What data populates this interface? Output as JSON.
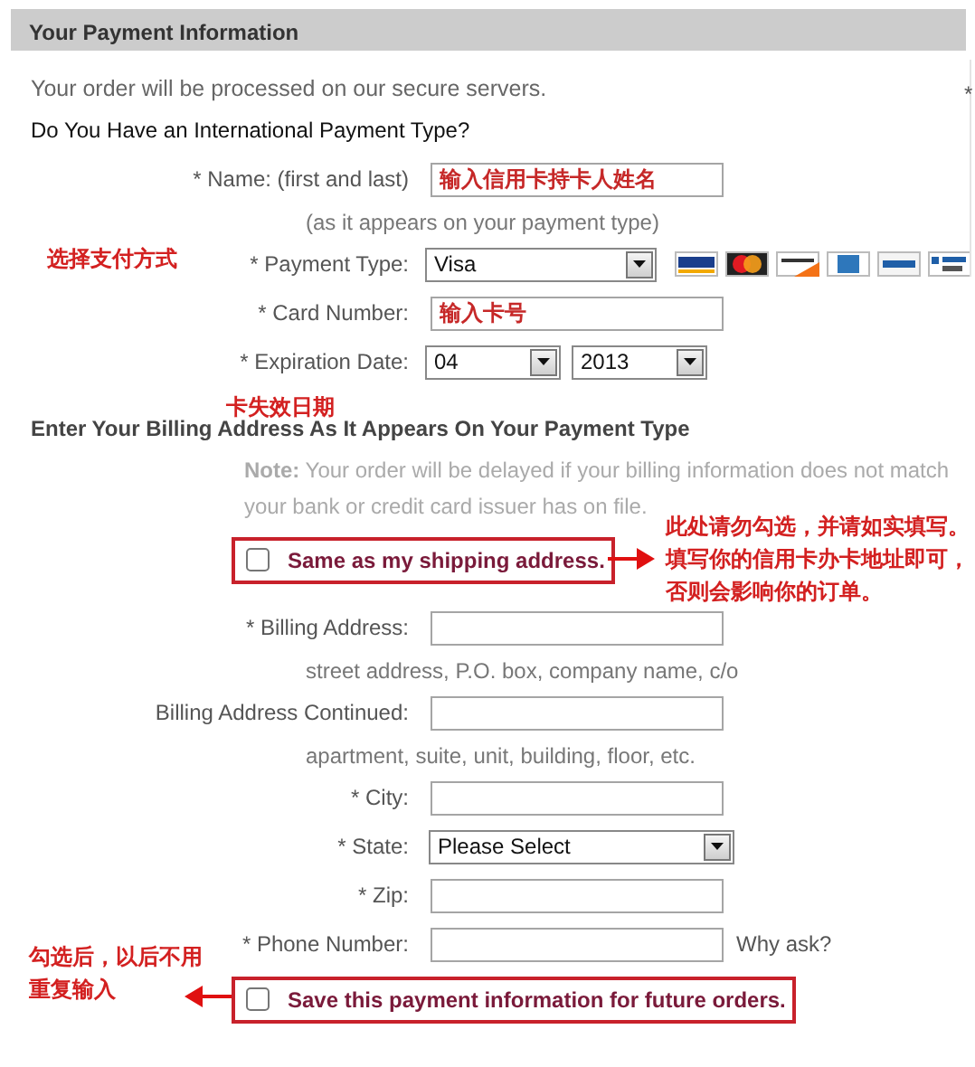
{
  "header": {
    "title": "Your Payment Information"
  },
  "edge_mark": "*",
  "intro": "Your order will be processed on our secure servers.",
  "question": "Do You Have an International Payment Type?",
  "payment_fields": [
    {
      "kind": "input",
      "label": "* Name: (first and last)",
      "value": "输入信用卡持卡人姓名",
      "hint": "(as it appears on your payment type)"
    },
    {
      "kind": "select",
      "label": "* Payment Type:",
      "value": "Visa"
    },
    {
      "kind": "input",
      "label": "* Card Number:",
      "value": "输入卡号"
    },
    {
      "kind": "date",
      "label": "* Expiration Date:",
      "month": "04",
      "year": "2013"
    }
  ],
  "billing_heading": "Enter Your Billing Address As It Appears On Your Payment Type",
  "note_lines": [
    "**Note:** Your order will be delayed if your billing information does not match",
    "your bank or credit card issuer has on file."
  ],
  "same_checkbox": {
    "label": "Same as my shipping address.",
    "checked": false
  },
  "address_fields": [
    {
      "kind": "input",
      "label": "* Billing Address:",
      "hint": "street address, P.O. box, company name, c/o"
    },
    {
      "kind": "input",
      "label": "Billing Address Continued:",
      "hint": "apartment, suite, unit, building, floor, etc."
    },
    {
      "kind": "input",
      "label": "* City:"
    },
    {
      "kind": "select",
      "label": "* State:",
      "value": "Please Select"
    },
    {
      "kind": "input",
      "label": "* Zip:"
    },
    {
      "kind": "input",
      "label": "* Phone Number:",
      "aside": "Why ask?"
    }
  ],
  "save_checkbox": {
    "label": "Save this payment information for future orders.",
    "checked": false
  },
  "annotations": [
    {
      "text": "选择支付方式"
    },
    {
      "text": "卡失效日期"
    },
    {
      "text": "此处请勿勾选，并请如实填写。填写你的信用卡办卡地址即可，否则会影响你的订单。"
    },
    {
      "text": "勾选后，以后不用重复输入"
    }
  ]
}
